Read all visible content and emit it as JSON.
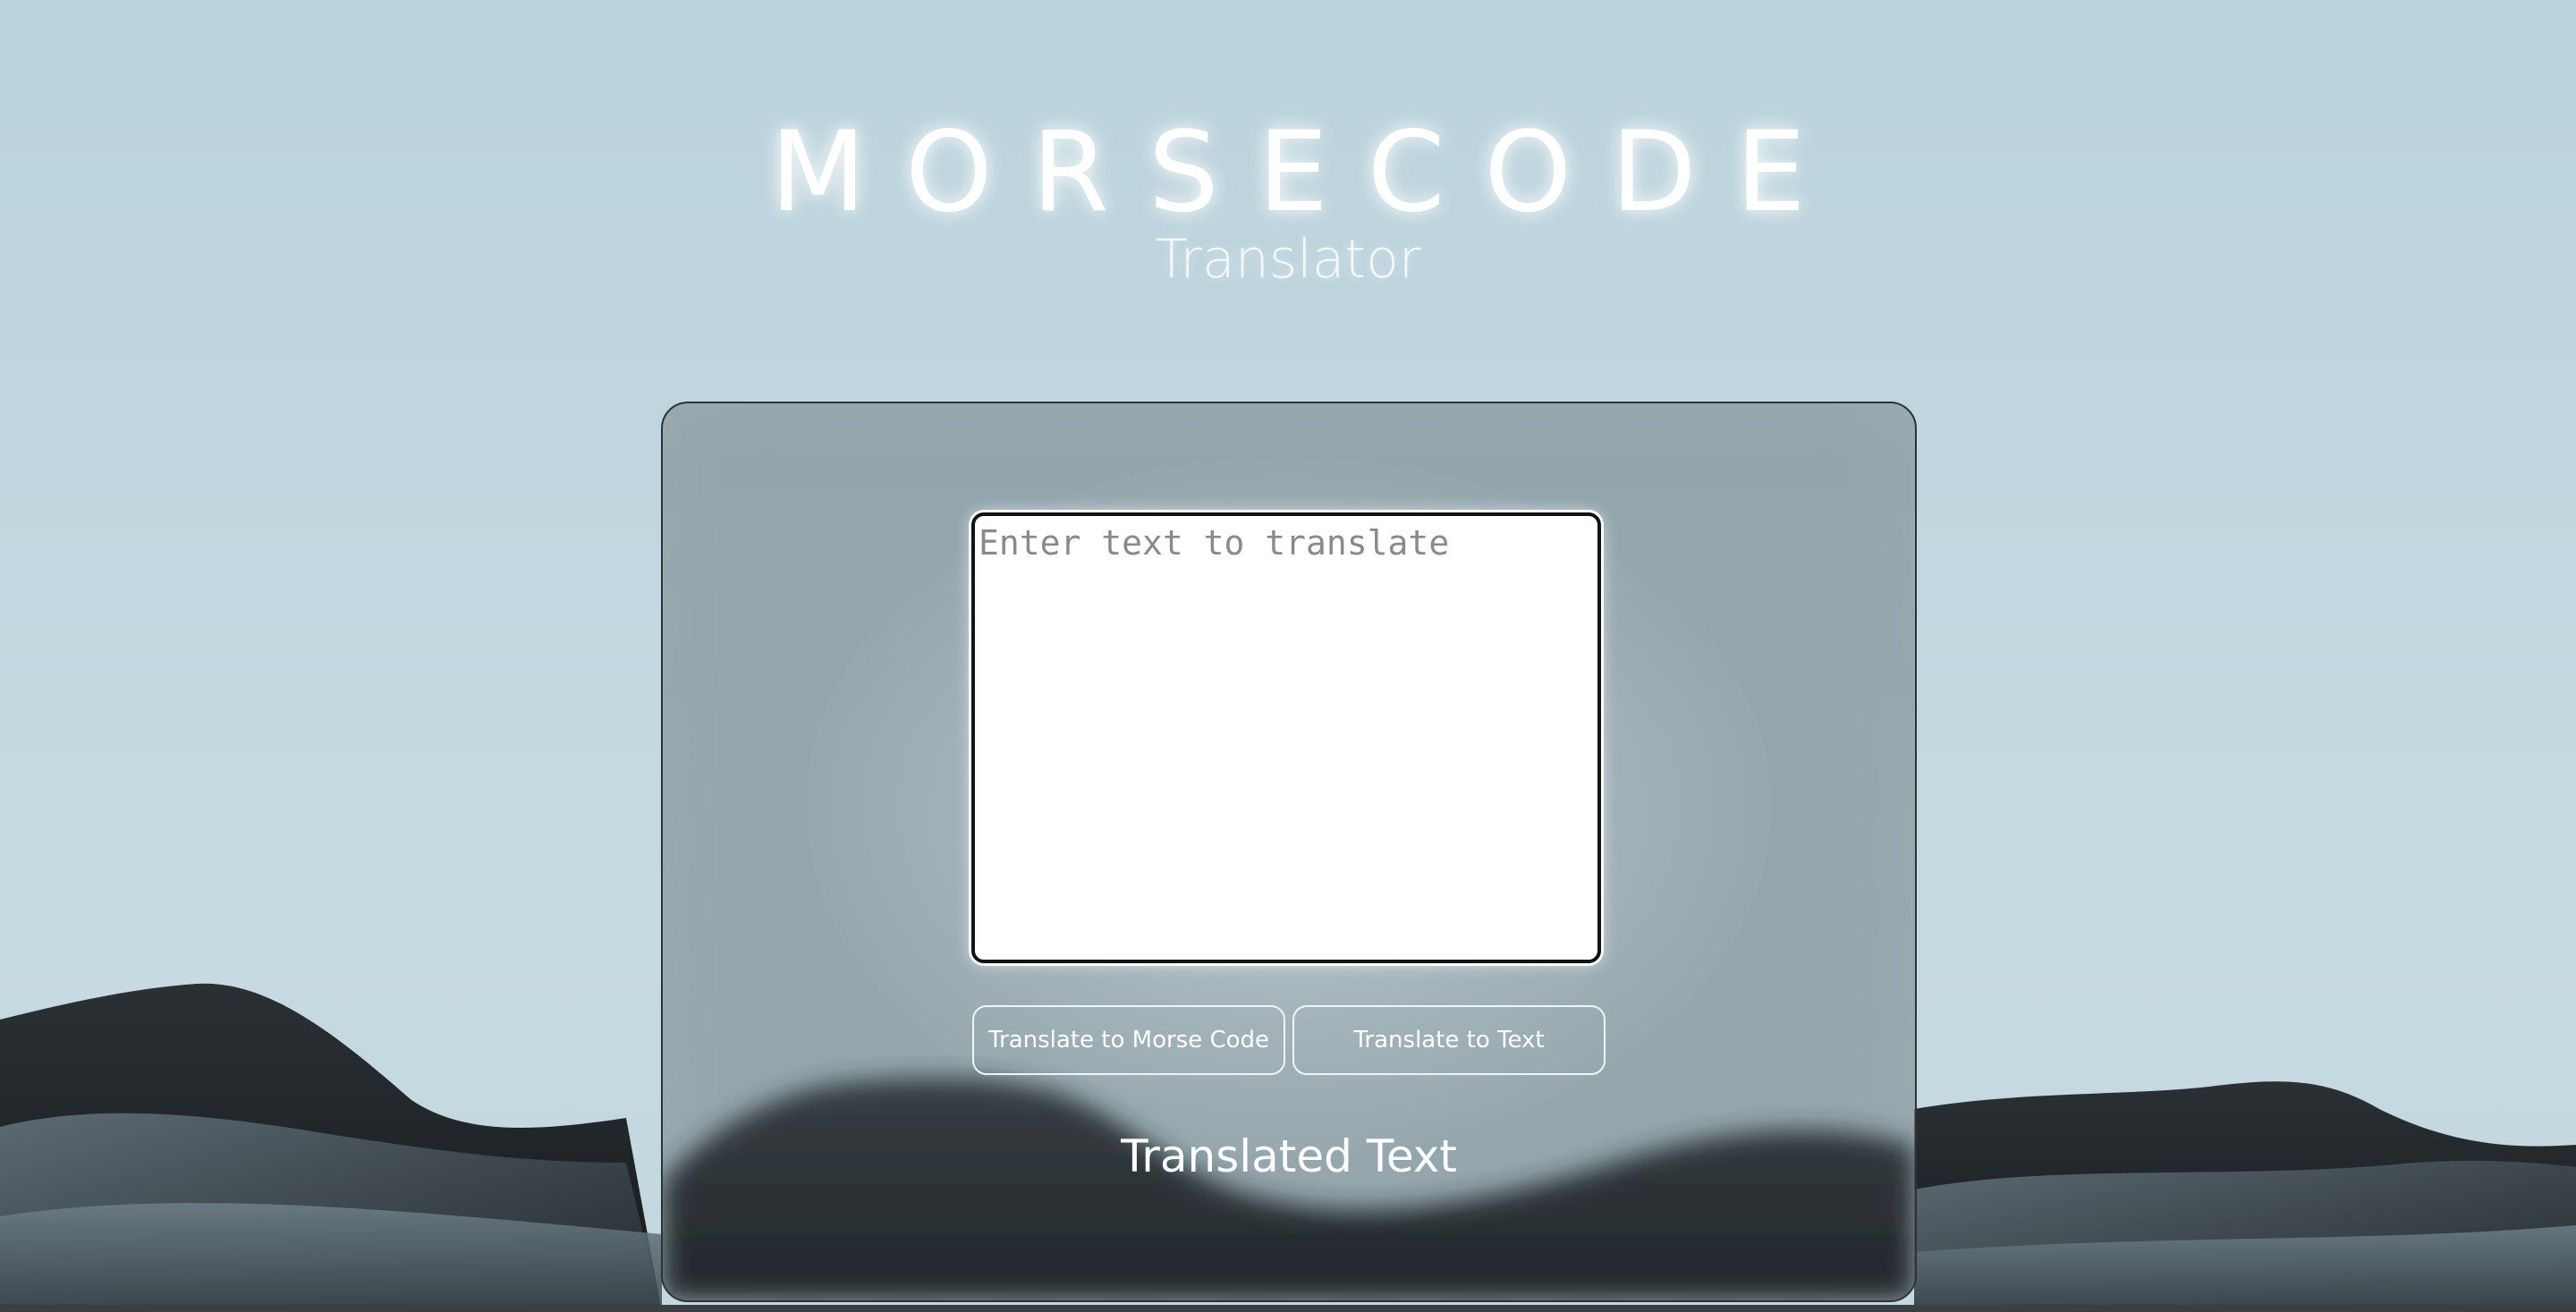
{
  "header": {
    "title": "MORSECODE",
    "subtitle": "Translator"
  },
  "translator": {
    "input_placeholder": "Enter text to translate",
    "input_value": "",
    "to_morse_label": "Translate to Morse Code",
    "to_text_label": "Translate to Text",
    "result_label": "Translated Text"
  },
  "colors": {
    "sky": "#c1d6de",
    "dune_dark": "#1e2428",
    "card_border": "#2e3337",
    "text_white": "#ffffff"
  }
}
